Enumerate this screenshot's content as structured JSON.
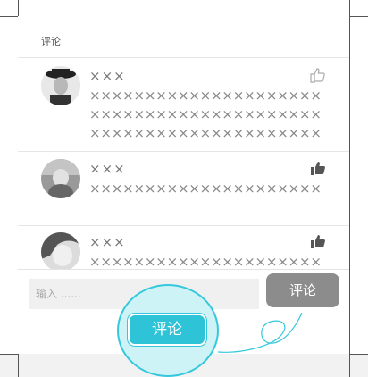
{
  "section": {
    "title": "评论"
  },
  "comments": [
    {
      "name": "×××",
      "lines": [
        "×××××××××××××××××××××",
        "×××××××××××××××××××××",
        "×××××××××××××××××××××"
      ],
      "liked": false
    },
    {
      "name": "×××",
      "lines": [
        "×××××××××××××××××××××"
      ],
      "liked": true
    },
    {
      "name": "×××",
      "lines": [
        "×××××××××××××××××××××"
      ],
      "liked": true
    }
  ],
  "input": {
    "placeholder": "输入 ......"
  },
  "send_button": {
    "label": "评论"
  },
  "zoom_callout": {
    "label": "评论"
  },
  "colors": {
    "accent": "#2fc3d8",
    "like_active": "#555555",
    "like_inactive": "#aaaaaa",
    "button_gray": "#8c8c8c"
  }
}
